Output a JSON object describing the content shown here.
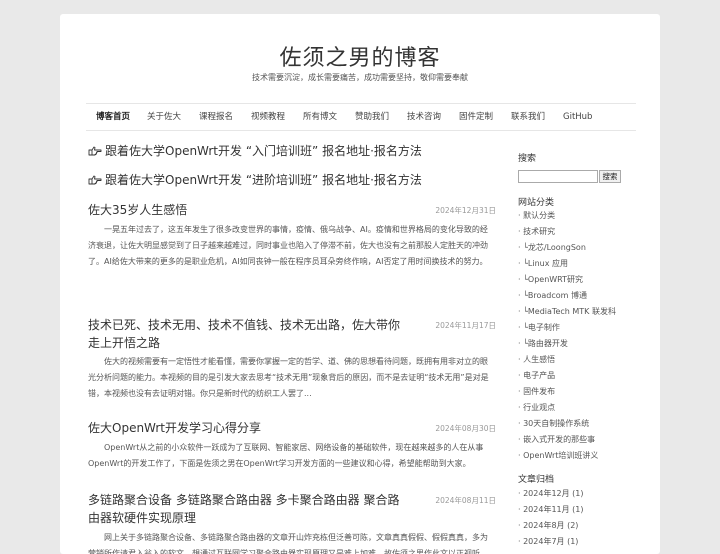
{
  "site": {
    "title": "佐须之男的博客",
    "description": "技术需要沉淀，成长需要痛苦，成功需要坚持，敬仰需要奉献"
  },
  "nav": {
    "items": [
      {
        "label": "博客首页",
        "active": true
      },
      {
        "label": "关于佐大"
      },
      {
        "label": "课程报名"
      },
      {
        "label": "视频教程"
      },
      {
        "label": "所有博文"
      },
      {
        "label": "赞助我们"
      },
      {
        "label": "技术咨询"
      },
      {
        "label": "固件定制"
      },
      {
        "label": "联系我们"
      },
      {
        "label": "GitHub"
      }
    ]
  },
  "sticky_posts": [
    {
      "icon": "hand-pointing-right-icon",
      "title": "跟着佐大学OpenWrt开发 “入门培训班” 报名地址·报名方法"
    },
    {
      "icon": "hand-pointing-right-icon",
      "title": "跟着佐大学OpenWrt开发 “进阶培训班” 报名地址·报名方法"
    }
  ],
  "posts": [
    {
      "title": "佐大35岁人生感悟",
      "date": "2024年12月31日",
      "excerpt": "一晃五年过去了，这五年发生了很多改变世界的事情，疫情、俄乌战争、AI。疫情和世界格局的变化导致的经济衰退，让佐大明显感觉到了日子越来越难过，同时事业也陷入了停滞不前，佐大也没有之前那股人定胜天的冲劲了。AI给佐大带来的更多的是职业危机，AI如同丧钟一般在程序员耳朵旁终作响，AI否定了用时间换技术的努力。"
    },
    {
      "title": "技术已死、技术无用、技术不值钱、技术无出路，佐大带你走上开悟之路",
      "date": "2024年11月17日",
      "excerpt": "佐大的视频需要有一定悟性才能看懂，需要你掌握一定的哲学、道、佛的思想看待问题，既拥有用非对立的眼光分析问题的能力。本视频的目的是引发大家去思考“技术无用”现象背后的原因，而不是去证明“技术无用”是对是错，本视频也没有去证明对错。你只是新时代的纺织工人罢了..."
    },
    {
      "title": "佐大OpenWrt开发学习心得分享",
      "date": "2024年08月30日",
      "excerpt": "OpenWrt从之前的小众软件一跃成为了互联网、智能家居、网络设备的基础软件，现在越来越多的人在从事OpenWrt的开发工作了，下面是佐须之男在OpenWrt学习开发方面的一些建议和心得，希望能帮助到大家。"
    },
    {
      "title": "多链路聚合设备 多链路聚合路由器 多卡聚合路由器 聚合路由器软硬件实现原理",
      "date": "2024年08月11日",
      "excerpt": "网上关于多链路聚合设备、多链路聚合路由器的文章开山炸充栋但泛善可陈，文章真真假假、假假真真，多为营销所作请君入瓮入的软文，想通过互联网学习聚合路由器实现原理又是难上加难，故佐须之男作此文以正视听，希望能为广大读者提供有价值的参考。"
    }
  ],
  "sidebar": {
    "search": {
      "title": "搜索",
      "placeholder": "",
      "button_label": "搜索"
    },
    "categories": {
      "title": "网站分类",
      "items": [
        "· 默认分类",
        "· 技术研究",
        "· └龙芯/LoongSon",
        "· └Linux 应用",
        "· └OpenWRT研究",
        "· └Broadcom 博通",
        "· └MediaTech MTK 联发科",
        "· └电子制作",
        "· └路由器开发",
        "· 人生感悟",
        "· 电子产品",
        "· 固件发布",
        "· 行业观点",
        "· 30天自制操作系统",
        "· 嵌入式开发的那些事",
        "· OpenWrt培训班讲义"
      ]
    },
    "archives": {
      "title": "文章归档",
      "items": [
        "· 2024年12月 (1)",
        "· 2024年11月 (1)",
        "· 2024年8月 (2)",
        "· 2024年7月 (1)"
      ]
    }
  }
}
